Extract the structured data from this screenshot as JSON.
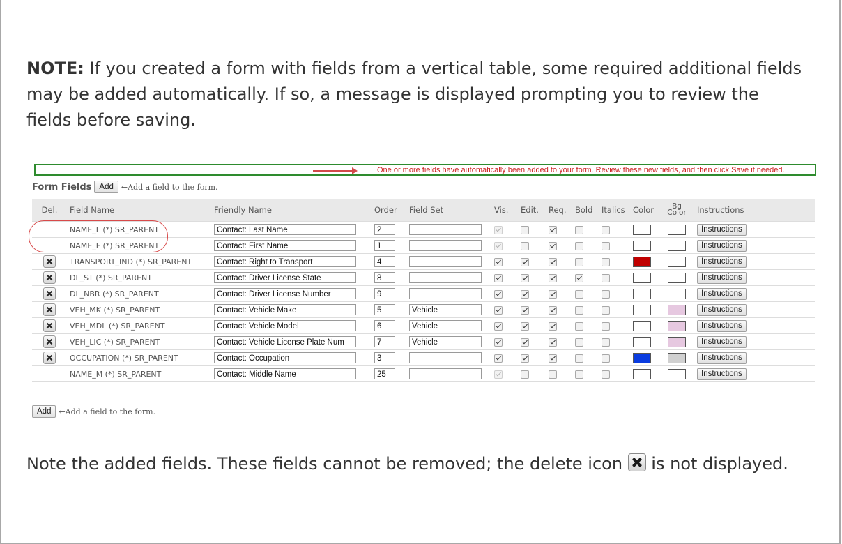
{
  "note1": {
    "label": "NOTE:",
    "text": " If you created a form with fields from a vertical table, some required additional fields may be added automatically. If so, a message is displayed prompting you to review the fields before saving."
  },
  "message": "One or more fields have automatically been added to your form. Review these new fields, and then click Save if needed.",
  "form": {
    "title": "Form Fields",
    "add_label": "Add",
    "add_hint": "←Add a field to the form."
  },
  "columns": {
    "del": "Del.",
    "field_name": "Field Name",
    "friendly_name": "Friendly Name",
    "order": "Order",
    "field_set": "Field Set",
    "vis": "Vis.",
    "edit": "Edit.",
    "req": "Req.",
    "bold": "Bold",
    "italics": "Italics",
    "color": "Color",
    "bg_color": "Bg Color",
    "instructions": "Instructions"
  },
  "rows": [
    {
      "deletable": false,
      "field_name": "NAME_L (*) SR_PARENT",
      "friendly_name": "Contact: Last Name",
      "order": "2",
      "field_set": "",
      "vis": true,
      "vis_disabled": true,
      "edit": false,
      "req": true,
      "bold": false,
      "italics": false,
      "color": "#ffffff",
      "bg_color": "#ffffff",
      "instructions": "Instructions"
    },
    {
      "deletable": false,
      "field_name": "NAME_F (*) SR_PARENT",
      "friendly_name": "Contact: First Name",
      "order": "1",
      "field_set": "",
      "vis": true,
      "vis_disabled": true,
      "edit": false,
      "req": true,
      "bold": false,
      "italics": false,
      "color": "#ffffff",
      "bg_color": "#ffffff",
      "instructions": "Instructions"
    },
    {
      "deletable": true,
      "field_name": "TRANSPORT_IND (*) SR_PARENT",
      "friendly_name": "Contact: Right to Transport",
      "order": "4",
      "field_set": "",
      "vis": true,
      "vis_disabled": false,
      "edit": true,
      "req": true,
      "bold": false,
      "italics": false,
      "color": "#c00000",
      "bg_color": "#ffffff",
      "instructions": "Instructions"
    },
    {
      "deletable": true,
      "field_name": "DL_ST (*) SR_PARENT",
      "friendly_name": "Contact: Driver License State",
      "order": "8",
      "field_set": "",
      "vis": true,
      "vis_disabled": false,
      "edit": true,
      "req": true,
      "bold": true,
      "italics": false,
      "color": "#ffffff",
      "bg_color": "#ffffff",
      "instructions": "Instructions"
    },
    {
      "deletable": true,
      "field_name": "DL_NBR (*) SR_PARENT",
      "friendly_name": "Contact: Driver License Number",
      "order": "9",
      "field_set": "",
      "vis": true,
      "vis_disabled": false,
      "edit": true,
      "req": true,
      "bold": false,
      "italics": false,
      "color": "#ffffff",
      "bg_color": "#ffffff",
      "instructions": "Instructions"
    },
    {
      "deletable": true,
      "field_name": "VEH_MK (*) SR_PARENT",
      "friendly_name": "Contact: Vehicle Make",
      "order": "5",
      "field_set": "Vehicle",
      "vis": true,
      "vis_disabled": false,
      "edit": true,
      "req": true,
      "bold": false,
      "italics": false,
      "color": "#ffffff",
      "bg_color": "#e6c8e0",
      "instructions": "Instructions"
    },
    {
      "deletable": true,
      "field_name": "VEH_MDL (*) SR_PARENT",
      "friendly_name": "Contact: Vehicle Model",
      "order": "6",
      "field_set": "Vehicle",
      "vis": true,
      "vis_disabled": false,
      "edit": true,
      "req": true,
      "bold": false,
      "italics": false,
      "color": "#ffffff",
      "bg_color": "#e6c8e0",
      "instructions": "Instructions"
    },
    {
      "deletable": true,
      "field_name": "VEH_LIC (*) SR_PARENT",
      "friendly_name": "Contact: Vehicle License Plate Num",
      "order": "7",
      "field_set": "Vehicle",
      "vis": true,
      "vis_disabled": false,
      "edit": true,
      "req": true,
      "bold": false,
      "italics": false,
      "color": "#ffffff",
      "bg_color": "#e6c8e0",
      "instructions": "Instructions"
    },
    {
      "deletable": true,
      "field_name": "OCCUPATION (*) SR_PARENT",
      "friendly_name": "Contact: Occupation",
      "order": "3",
      "field_set": "",
      "vis": true,
      "vis_disabled": false,
      "edit": true,
      "req": true,
      "bold": false,
      "italics": false,
      "color": "#0a3ce0",
      "bg_color": "#d0d0d0",
      "instructions": "Instructions"
    },
    {
      "deletable": false,
      "field_name": "NAME_M (*) SR_PARENT",
      "friendly_name": "Contact: Middle Name",
      "order": "25",
      "field_set": "",
      "vis": true,
      "vis_disabled": true,
      "edit": false,
      "req": false,
      "bold": false,
      "italics": false,
      "color": "#ffffff",
      "bg_color": "#ffffff",
      "instructions": "Instructions"
    }
  ],
  "note2": {
    "before": "Note the added fields. These fields cannot be removed; the delete icon ",
    "after": " is not displayed."
  }
}
